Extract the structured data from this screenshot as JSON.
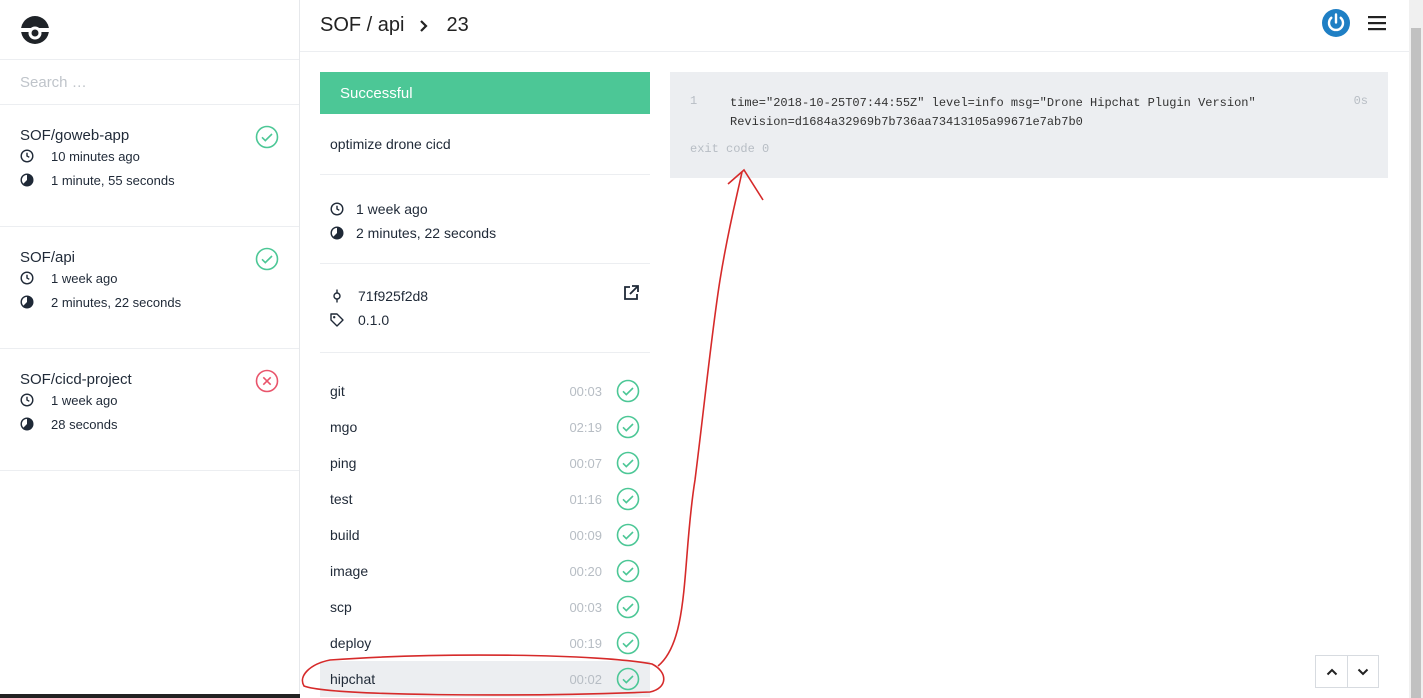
{
  "search": {
    "placeholder": "Search …"
  },
  "repos": [
    {
      "name": "SOF/goweb-app",
      "status": "success",
      "started": "10 minutes ago",
      "duration": "1 minute, 55 seconds"
    },
    {
      "name": "SOF/api",
      "status": "success",
      "started": "1 week ago",
      "duration": "2 minutes, 22 seconds"
    },
    {
      "name": "SOF/cicd-project",
      "status": "failure",
      "started": "1 week ago",
      "duration": "28 seconds"
    }
  ],
  "header": {
    "owner_repo": "SOF / api",
    "build_number": "23"
  },
  "build": {
    "status": "Successful",
    "message": "optimize drone cicd",
    "started": "1 week ago",
    "duration": "2 minutes, 22 seconds",
    "commit": "71f925f2d8",
    "tag": "0.1.0"
  },
  "steps": [
    {
      "name": "git",
      "time": "00:03"
    },
    {
      "name": "mgo",
      "time": "02:19"
    },
    {
      "name": "ping",
      "time": "00:07"
    },
    {
      "name": "test",
      "time": "01:16"
    },
    {
      "name": "build",
      "time": "00:09"
    },
    {
      "name": "image",
      "time": "00:20"
    },
    {
      "name": "scp",
      "time": "00:03"
    },
    {
      "name": "deploy",
      "time": "00:19"
    },
    {
      "name": "hipchat",
      "time": "00:02"
    }
  ],
  "log": {
    "line_number": "1",
    "line1": "time=\"2018-10-25T07:44:55Z\" level=info msg=\"Drone Hipchat Plugin Version\"",
    "line2": "Revision=d1684a32969b7b736aa73413105a99671e7ab7b0",
    "duration": "0s",
    "exit": "exit code 0"
  },
  "colors": {
    "success": "#4cc796",
    "failure": "#e9546b",
    "power": "#1f7fc4",
    "log_bg": "#eceef1"
  }
}
